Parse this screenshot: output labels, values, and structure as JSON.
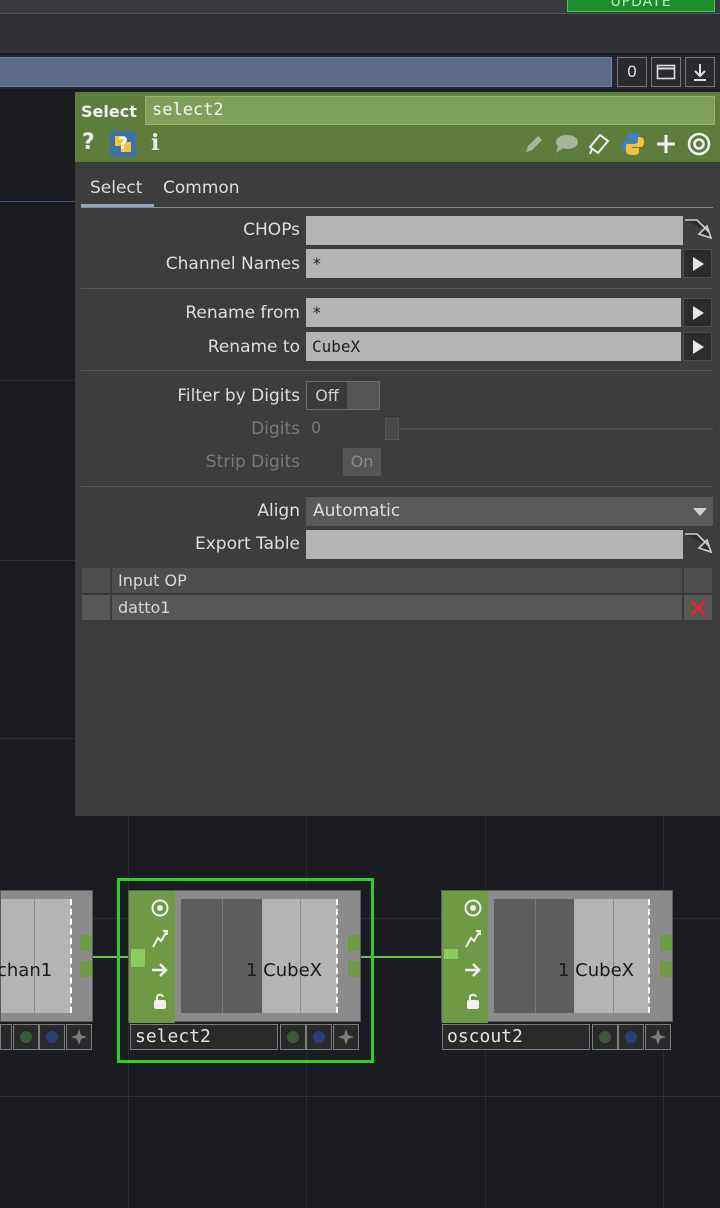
{
  "toolbar": {
    "update_label": "UPDATE",
    "zero_label": "0",
    "window_icon": "window-icon",
    "down_icon": "download-icon"
  },
  "panel": {
    "op_type": "Select",
    "op_name": "select2",
    "header_icons": [
      "help-icon",
      "python-help-icon",
      "info-icon"
    ],
    "right_icons": [
      "pencil-icon",
      "comment-icon",
      "clipboard-icon",
      "python-icon",
      "add-icon",
      "viewer-icon"
    ],
    "tabs": [
      {
        "label": "Select",
        "active": true
      },
      {
        "label": "Common",
        "active": false
      }
    ],
    "params": {
      "chops_label": "CHOPs",
      "chops_value": "",
      "channel_names_label": "Channel Names",
      "channel_names_value": "*",
      "rename_from_label": "Rename from",
      "rename_from_value": "*",
      "rename_to_label": "Rename to",
      "rename_to_value": "CubeX",
      "filter_label": "Filter by Digits",
      "filter_value": "Off",
      "digits_label": "Digits",
      "digits_value": "0",
      "strip_label": "Strip Digits",
      "strip_value": "On",
      "align_label": "Align",
      "align_value": "Automatic",
      "export_label": "Export Table",
      "export_value": ""
    },
    "table": {
      "header": "Input OP",
      "rows": [
        "datto1"
      ]
    }
  },
  "nodes": [
    {
      "name": "",
      "label": "chan1"
    },
    {
      "name": "select2",
      "label": "1 CubeX"
    },
    {
      "name": "oscout2",
      "label": "1 CubeX"
    }
  ],
  "colors": {
    "accent_green": "#6f9a45",
    "selected_outline": "#2bd12b",
    "path_bar": "#5d6b8a"
  }
}
